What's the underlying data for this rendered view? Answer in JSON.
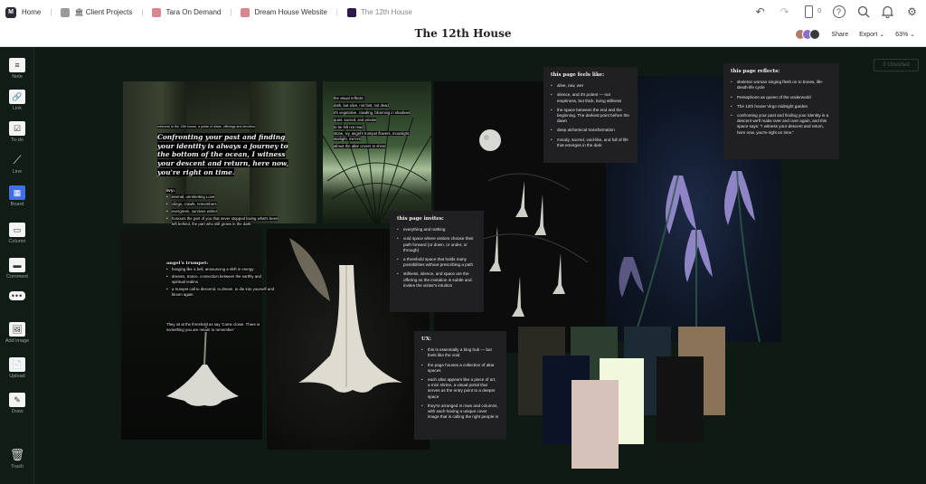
{
  "breadcrumbs": [
    {
      "label": "Home",
      "color": "#2a2a35"
    },
    {
      "label": "🏛 Client Projects",
      "color": "#9a9a9a"
    },
    {
      "label": "Tara On Demand",
      "color": "#d9868e"
    },
    {
      "label": "Dream House Website",
      "color": "#d9868e"
    },
    {
      "label": "The 12th House",
      "color": "#2e1a4a"
    }
  ],
  "topbar": {
    "device_count": "0"
  },
  "board": {
    "title": "The 12th House",
    "share_label": "Share",
    "export_label": "Export",
    "zoom": "63%"
  },
  "toolbar": {
    "note": "Note",
    "link": "Link",
    "todo": "To-do",
    "line": "Line",
    "board": "Board",
    "column": "Column",
    "comment": "Comment",
    "add_image": "Add image",
    "upload": "Upload",
    "draw": "Draw",
    "trash": "Trash"
  },
  "unsorted": "0 Unsorted",
  "overlay1": {
    "small": "welcome to the 12th house, a portal of altars, offerings and devotion",
    "title": "Confronting your past and finding your identity is always a journey to the bottom of the ocean, I witness your descent and return, here now, you're right on time.",
    "ivy_heading": "ivy:",
    "ivy_items": [
      "eternal, unrelenting Love",
      "clings, crawls, remembers",
      "evergreen, survives winter",
      "honours the part of you that never stopped loving what's been left behind, the part who still grows in the dark"
    ],
    "angel_heading": "angel's trumpet:",
    "angel_items": [
      "hanging like a bell, announcing a shift in energy",
      "dreams, trance, connection between the earthly and spiritual realms",
      "a trumpet call to descend, to dream, to die into yourself and bloom again"
    ],
    "closing": "They sit at the threshold as say 'Come closer. There is something you are meant to remember.'"
  },
  "overlay2": {
    "lines": [
      "the visual reflects:",
      "dark, but alive, not fast, not dead",
      "it's vegetative, crawling, blooming in shadows",
      "quiet, sacred, and private",
      "to be felt not read",
      "stone, ivy, angel's trumpet flowers, moonlight, starlight, mirrors",
      "allows the altar covers to shine"
    ]
  },
  "note_feels": {
    "heading": "this page feels like:",
    "items": [
      "alive, raw, wet",
      "silence, and it's potent — not emptiness, but thick, living stillness",
      "the space between the end and the beginning. The darkest point before the dawn",
      "deep alchemical transformation",
      "moody, sacred, void-like, and full of life that emerges in the dark"
    ]
  },
  "note_invites": {
    "heading": "this page invites:",
    "items": [
      "everything and nothing",
      "void space where visitors choose their path forward (or down, or under, or through)",
      "a threshold space that holds many possibilities without prescribing a path",
      "stillness, silence, and space are the offering so the invitation is subtle and invites the visitor's intuition"
    ]
  },
  "note_reflects": {
    "heading": "this page reflects:",
    "items": [
      "skeleton woman singing flesh on to bones, life-death-life cycle",
      "Persephone as queen of the underworld",
      "The 12th house Virgo midnight garden",
      "confronting your past and finding your identity is a descent we'll make over and over again, and this space says: \"I witness your descent and return, here now, you're right on time.\""
    ]
  },
  "note_ux": {
    "heading": "UX:",
    "items": [
      "this is essentially a blog hub — but feels like the void",
      "the page houses a collection of altar spaces",
      "each altar appears like a piece of art, a mini shrine, a visual portal that serves as the entry point to a deeper space",
      "they're arranged in rows and columns, with each having a unique cover image that is calling the right people in"
    ]
  },
  "palette": [
    "#2a2a22",
    "#2c3e2f",
    "#1c2a33",
    "#8a7356",
    "#0d1326",
    "#f2f8dc",
    "#121212",
    "#d6c2b9"
  ]
}
